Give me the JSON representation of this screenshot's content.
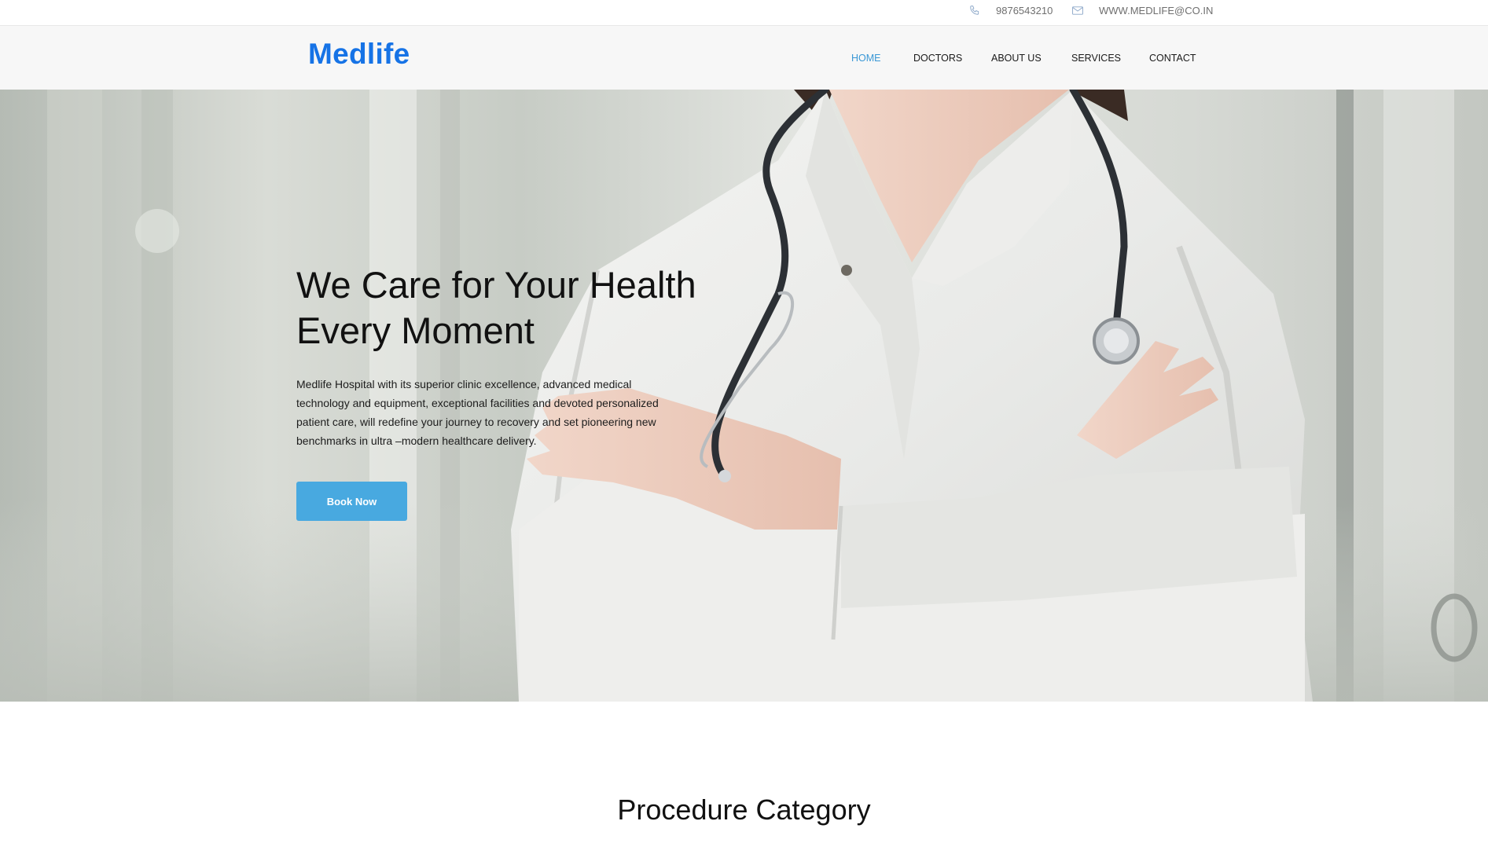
{
  "topbar": {
    "phone": "9876543210",
    "phone_icon": "phone-icon",
    "email": "WWW.MEDLIFE@CO.IN",
    "email_icon": "mail-icon"
  },
  "brand": {
    "name": "Medlife",
    "color": "#1673e6"
  },
  "nav": {
    "items": [
      {
        "label": "HOME",
        "active": true
      },
      {
        "label": "DOCTORS",
        "active": false
      },
      {
        "label": "ABOUT US",
        "active": false
      },
      {
        "label": "SERVICES",
        "active": false
      },
      {
        "label": "CONTACT",
        "active": false
      }
    ],
    "active_color": "#3a98d6"
  },
  "hero": {
    "title_line1": "We Care for Your Health",
    "title_line2": "Every Moment",
    "description": "Medlife Hospital with its superior clinic excellence, advanced medical technology and equipment, exceptional facilities and devoted personalized patient care, will redefine your journey to recovery and set pioneering new benchmarks in ultra –modern healthcare delivery.",
    "cta_label": "Book Now",
    "cta_color": "#48a9e0"
  },
  "section": {
    "title": "Procedure Category"
  }
}
